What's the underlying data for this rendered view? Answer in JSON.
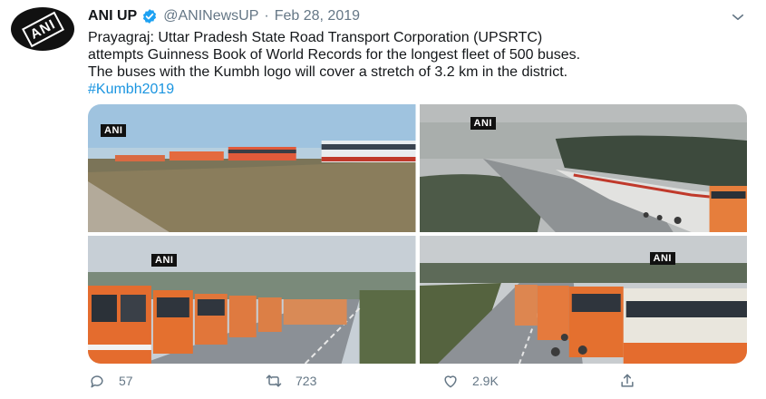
{
  "account": {
    "name": "ANI UP",
    "handle": "@ANINewsUP",
    "separator": "·",
    "date": "Feb 28, 2019",
    "avatar_logo": "ANI"
  },
  "tweet": {
    "line1": "Prayagraj: Uttar Pradesh State Road Transport Corporation (UPSRTC)",
    "line2": "attempts Guinness Book of World Records for the longest fleet of 500 buses.",
    "line3": "The buses with the Kumbh logo will cover a stretch of 3.2 km in the district.",
    "hashtag": "#Kumbh2019"
  },
  "media": {
    "tags": [
      "ANI",
      "ANI",
      "ANI",
      "ANI"
    ]
  },
  "actions": {
    "replies": "57",
    "retweets": "723",
    "likes": "2.9K"
  },
  "icons": {
    "verified": "verified-badge-icon",
    "menu": "chevron-down-icon",
    "reply": "reply-icon",
    "retweet": "retweet-icon",
    "like": "heart-icon",
    "share": "share-icon"
  },
  "colors": {
    "text": "#14171a",
    "muted": "#657786",
    "link": "#1b95e0",
    "verified": "#1da1f2"
  }
}
